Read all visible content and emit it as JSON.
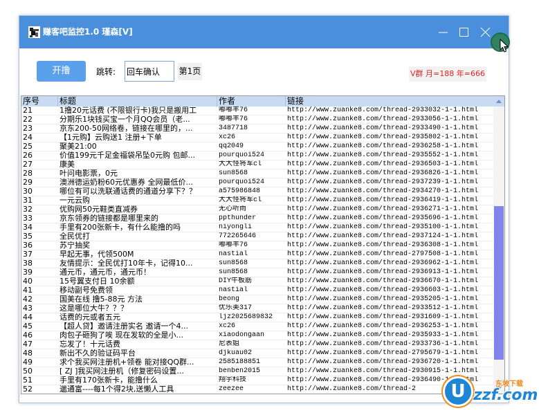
{
  "window": {
    "title": "赚客吧监控1.0 瑾森[V]"
  },
  "toolbar": {
    "start_label": "开撸",
    "jump_label": "跳转:",
    "jump_input_value": "回车确认",
    "page_label": "第1页",
    "vip_text": "V群 月=188 年=666"
  },
  "table": {
    "columns": [
      "序号",
      "标题",
      "作者",
      "链接"
    ],
    "rows": [
      {
        "no": "21",
        "title": "1撸20元话费 (不限银行卡)我只是搬用工",
        "author": "嘟嘟羊76",
        "link": "http://www.zuanke8.com/thread-2933032-1-1.html"
      },
      {
        "no": "22",
        "title": "分期乐1块钱买宝一个月QQ会员（老...",
        "author": "嘟嘟羊76",
        "link": "http://www.zuanke8.com/thread-2933056-1-1.html"
      },
      {
        "no": "23",
        "title": "京东200-50网络卷，链接在哪里的，...",
        "author": "3487718",
        "link": "http://www.zuanke8.com/thread-2933490-1-1.html"
      },
      {
        "no": "24",
        "title": "【1元购】云购送1  注册+下单",
        "author": "xc26",
        "link": "http://www.zuanke8.com/thread-2935802-1-1.html"
      },
      {
        "no": "25",
        "title": "聚美21:00",
        "author": "qq2049",
        "link": "http://www.zuanke8.com/thread-2936258-1-1.html"
      },
      {
        "no": "26",
        "title": "价值199元千足金福袋吊坠0元购 包邮...",
        "author": "pourquoi524",
        "link": "http://www.zuanke8.com/thread-2935552-1-1.html"
      },
      {
        "no": "27",
        "title": "康美",
        "author": "大大怪将军cl",
        "link": "http://www.zuanke8.com/thread-2936503-1-1.html"
      },
      {
        "no": "28",
        "title": "叶问电影票，0元",
        "author": "sun8568",
        "link": "http://www.zuanke8.com/thread-2936826-1-1.html"
      },
      {
        "no": "29",
        "title": "澳洲德运奶粉60元优惠券 全网最低价...",
        "author": "pourquoi524",
        "link": "http://www.zuanke8.com/thread-2937239-1-1.html"
      },
      {
        "no": "30",
        "title": "哪位有可以洗联通话费的通道分享下？？",
        "author": "a575986848",
        "link": "http://www.zuanke8.com/thread-2934270-1-1.html"
      },
      {
        "no": "31",
        "title": "一元云购",
        "author": "大大怪将军cl",
        "link": "http://www.zuanke8.com/thread-2936419-1-1.html"
      },
      {
        "no": "32",
        "title": "优购网50元鞋类直减券",
        "author": "无心听雨",
        "link": "http://www.zuanke8.com/thread-2936271-1-1.html"
      },
      {
        "no": "33",
        "title": "京东领券的链接都是哪里来的",
        "author": "ppthunder",
        "link": "http://www.zuanke8.com/thread-2935696-1-1.html"
      },
      {
        "no": "34",
        "title": "手里有200张新卡，有什么能撸的吗",
        "author": "niyongli",
        "link": "http://www.zuanke8.com/thread-2935100-1-1.html"
      },
      {
        "no": "35",
        "title": "全民优打",
        "author": "772265646",
        "link": "http://www.zuanke8.com/thread-2937124-1-1.html"
      },
      {
        "no": "36",
        "title": "苏宁抽奖",
        "author": "嘟嘟羊76",
        "link": "http://www.zuanke8.com/thread-2936308-1-1.html"
      },
      {
        "no": "37",
        "title": "早起无事，代领500M",
        "author": "nastial",
        "link": "http://www.zuanke8.com/thread-2797508-1-1.html"
      },
      {
        "no": "38",
        "title": "友情提示：全民优打10年卡，记得10...",
        "author": "sun8568",
        "link": "http://www.zuanke8.com/thread-2936962-1-1.html"
      },
      {
        "no": "39",
        "title": "通元币，通元币，通元币！",
        "author": "sun8568",
        "link": "http://www.zuanke8.com/thread-2936913-1-1.html"
      },
      {
        "no": "40",
        "title": "15号翼支付日 10余额",
        "author": "DIY牛板筋",
        "link": "http://www.zuanke8.com/thread-2936670-1-1.html"
      },
      {
        "no": "41",
        "title": "移动副号免费领",
        "author": "nastial",
        "link": "http://www.zuanke8.com/thread-2936603-1-1.html"
      },
      {
        "no": "42",
        "title": "国美在线 撸5-88元 方法",
        "author": "beong",
        "link": "http://www.zuanke8.com/thread-2935205-1-1.html"
      },
      {
        "no": "43",
        "title": "这是哪位大牛？？？",
        "author": "优乐美317",
        "link": "http://www.zuanke8.com/thread-2933512-1-1.html"
      },
      {
        "no": "44",
        "title": "话费的元或者五元",
        "author": "ljz2025689832",
        "link": "http://www.zuanke8.com/thread-2931609-1-1.html"
      },
      {
        "no": "45",
        "title": "【超人贷】邀请注册实名  邀请一个4...",
        "author": "xc26",
        "link": "http://www.zuanke8.com/thread-2936253-1-1.html"
      },
      {
        "no": "46",
        "title": "肉包子砸狗了唉  现在发软的全是小...",
        "author": "xiaodongaan",
        "link": "http://www.zuanke8.com/thread-2935933-1-1.html"
      },
      {
        "no": "47",
        "title": "忘发了！十元话费",
        "author": "尼表姐",
        "link": "http://www.zuanke8.com/thread-2933736-1-1.html"
      },
      {
        "no": "48",
        "title": "新出不久的验证码平台",
        "author": "djkuau02",
        "link": "http://www.zuanke8.com/thread-2795679-1-1.html"
      },
      {
        "no": "49",
        "title": "求个我买网注册机+领卷 能对接QQ群...",
        "author": "2585188851",
        "link": "http://www.zuanke8.com/thread-2936720-1-1.html"
      },
      {
        "no": "50",
        "title": "[ ZJ ]我买网注册机（修复密码设置...",
        "author": "benben2015",
        "link": "http://www.zuanke8.com/thread-2930915-1-1.html"
      },
      {
        "no": "51",
        "title": "手里有170张新卡，能撸什么",
        "author": "翔宇科技",
        "link": "http://www.zuanke8.com/thread-2936490-1-1.html"
      },
      {
        "no": "52",
        "title": "邋通富----每1个得2块,送懒人工具",
        "author": "zeezee",
        "link": "http://www.zuanke8.com/thread-2"
      }
    ]
  },
  "watermark": {
    "tagline": "东坡下载",
    "brand_initial": "U",
    "brand_rest": "zzf.com"
  },
  "icons": {
    "app": "app-icon",
    "minimize": "minimize-icon",
    "maximize": "maximize-icon",
    "close": "close-icon",
    "scroll_up": "scroll-up-arrow-icon",
    "scroll_down": "scroll-down-arrow-icon",
    "cursor": "mouse-pointer-icon"
  },
  "colors": {
    "title_bar": "#4a8fdc",
    "button": "#5ba0ea",
    "vip_text": "#e02424",
    "scroll_thumb": "#8383ec",
    "header_bg": "#c9dbf3"
  }
}
